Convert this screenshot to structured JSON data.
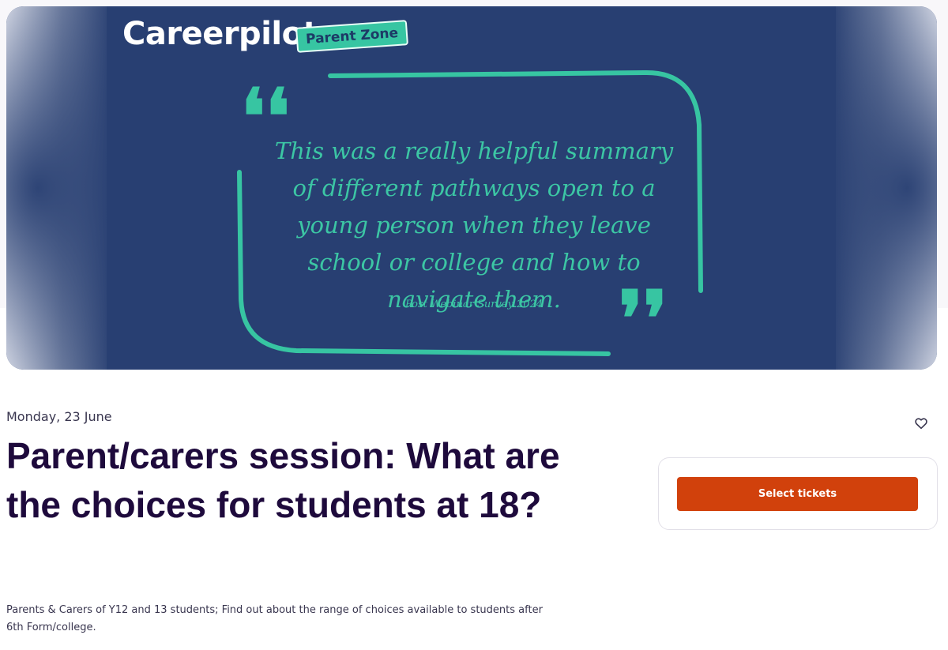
{
  "hero": {
    "brand": "Careerpilot",
    "badge": "Parent Zone",
    "quote": "This was a really helpful summary of different pathways open to a young person when they leave school or college and how to navigate them.",
    "quote_source": "Post Webinar Survey 2024",
    "open_quote": "❛❛",
    "close_quote": "❜❜"
  },
  "event": {
    "date": "Monday, 23 June",
    "title": "Parent/carers session: What are the choices for students at 18?",
    "summary": "Parents & Carers of Y12 and 13 students; Find out about the range of choices available to students after 6th Form/college."
  },
  "tickets": {
    "button_label": "Select tickets"
  },
  "colors": {
    "hero_bg": "#283f72",
    "accent_green": "#37c5a2",
    "cta_orange": "#d1410c",
    "title": "#1e0a3c"
  },
  "icons": {
    "like": "heart-icon"
  }
}
